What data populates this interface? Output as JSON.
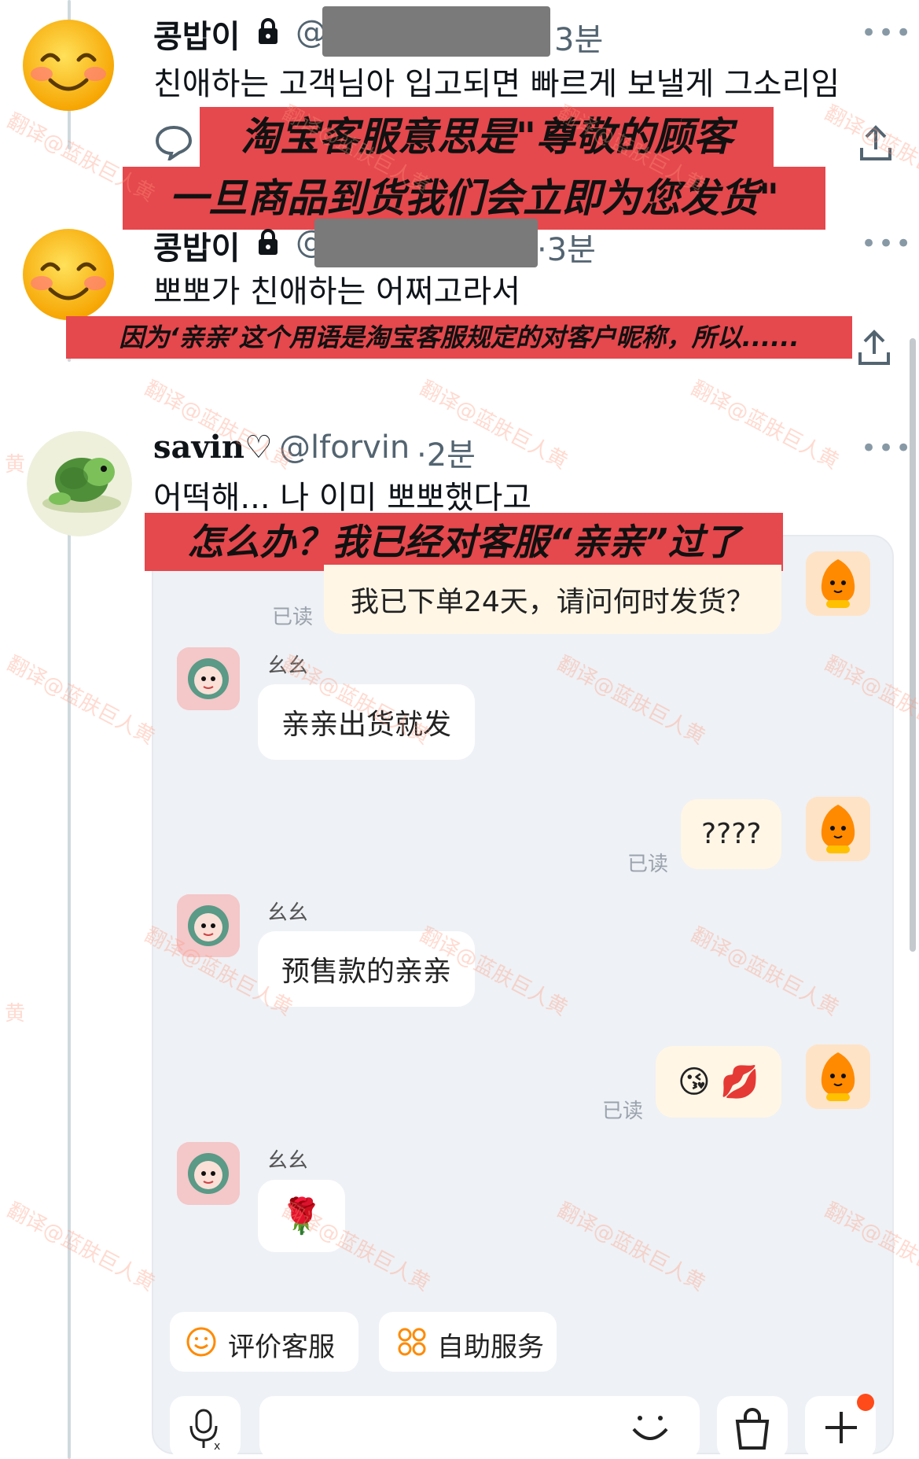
{
  "colors": {
    "red_banner": "#e5484d",
    "handle_gray": "#536471",
    "chat_bg": "#eef1f5",
    "my_bubble": "#fff6e6",
    "orange": "#ff8a00"
  },
  "tweets": [
    {
      "name": "콩밥이",
      "lock_icon": "lock-icon",
      "handle": "@",
      "time": "3분",
      "text": "친애하는 고객님아 입고되면 빠르게 보낼게 그소리임"
    },
    {
      "name": "콩밥이",
      "lock_icon": "lock-icon",
      "handle": "@",
      "time": "·3분",
      "text": "뽀뽀가 친애하는 어쩌고라서"
    },
    {
      "name": "savin♡",
      "handle": "@lforvin",
      "time": "·2분",
      "text": "어떡해... 나 이미 뽀뽀했다고"
    }
  ],
  "banners": {
    "banner1_line1": "淘宝客服意思是\"尊敬的顾客",
    "banner1_line2": "一旦商品到货我们会立即为您发货\"",
    "banner2": "因为‘亲亲’这个用语是淘宝客服规定的对客户昵称，所以......",
    "banner3": "怎么办？我已经对客服“亲亲”过了"
  },
  "chat": {
    "messages": [
      {
        "side": "right",
        "text": "我已下单24天，请问何时发货？",
        "read": "已读"
      },
      {
        "side": "left",
        "agent": "幺幺",
        "text": "亲亲出货就发"
      },
      {
        "side": "right",
        "text": "????",
        "read": "已读"
      },
      {
        "side": "left",
        "agent": "幺幺",
        "text": "预售款的亲亲"
      },
      {
        "side": "right",
        "text": "😘 💋",
        "read": "已读"
      },
      {
        "side": "left",
        "agent": "幺幺",
        "text": "🌹"
      }
    ],
    "actions": [
      {
        "label": "评价客服",
        "icon": "smiley-icon"
      },
      {
        "label": "自助服务",
        "icon": "grid-icon"
      }
    ],
    "bottom_icons": [
      "voice-input-icon",
      "emoji-icon",
      "shopping-bag-icon",
      "plus-icon"
    ]
  },
  "watermark_text": "翻译@蓝肤巨人黄",
  "watermark_fragment": "黄"
}
